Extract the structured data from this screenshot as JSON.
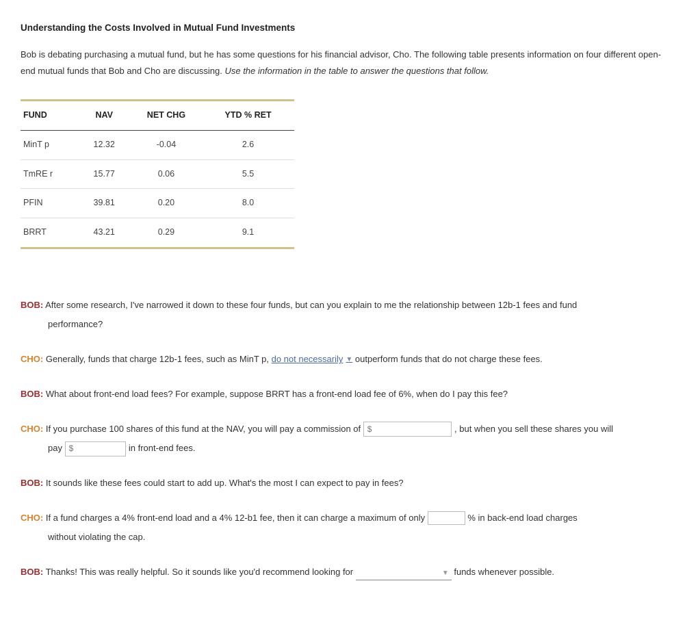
{
  "title": "Understanding the Costs Involved in Mutual Fund Investments",
  "intro_a": "Bob is debating purchasing a mutual fund, but he has some questions for his financial advisor, Cho. The following table presents information on four different open-end mutual funds that Bob and Cho are discussing. ",
  "intro_b": "Use the information in the table to answer the questions that follow.",
  "table": {
    "headers": {
      "fund": "FUND",
      "nav": "NAV",
      "netchg": "NET CHG",
      "ytd": "YTD % RET"
    },
    "rows": [
      {
        "fund": "MinT p",
        "nav": "12.32",
        "netchg": "-0.04",
        "ytd": "2.6"
      },
      {
        "fund": "TmRE r",
        "nav": "15.77",
        "netchg": "0.06",
        "ytd": "5.5"
      },
      {
        "fund": "PFIN",
        "nav": "39.81",
        "netchg": "0.20",
        "ytd": "8.0"
      },
      {
        "fund": "BRRT",
        "nav": "43.21",
        "netchg": "0.29",
        "ytd": "9.1"
      }
    ]
  },
  "labels": {
    "bob": "BOB:",
    "cho": "CHO:"
  },
  "q1": {
    "bob_a": " After some research, I've narrowed it down to these four funds, but can you explain to me the relationship between 12b-1 fees and fund",
    "bob_b": "performance?",
    "cho_a": " Generally, funds that charge 12b-1 fees, such as MinT p, ",
    "dropdown": "do not necessarily",
    "cho_b": " outperform funds that do not charge these fees."
  },
  "q2": {
    "bob": " What about front-end load fees? For example, suppose BRRT has a front-end load fee of 6%, when do I pay this fee?",
    "cho_a": " If you purchase 100 shares of this fund at the NAV, you will pay a commission of ",
    "cho_b": " , but when you sell these shares you will",
    "cho_c": "pay ",
    "cho_d": " in front-end fees.",
    "dollar": "$"
  },
  "q3": {
    "bob": " It sounds like these fees could start to add up. What's the most I can expect to pay in fees?",
    "cho_a": " If a fund charges a 4% front-end load and a 4% 12-b1 fee, then it can charge a maximum of only ",
    "cho_b": " % in back-end load charges",
    "cho_c": "without violating the cap."
  },
  "q4": {
    "bob_a": " Thanks! This was really helpful. So it sounds like you'd recommend looking for ",
    "bob_b": " funds whenever possible."
  }
}
